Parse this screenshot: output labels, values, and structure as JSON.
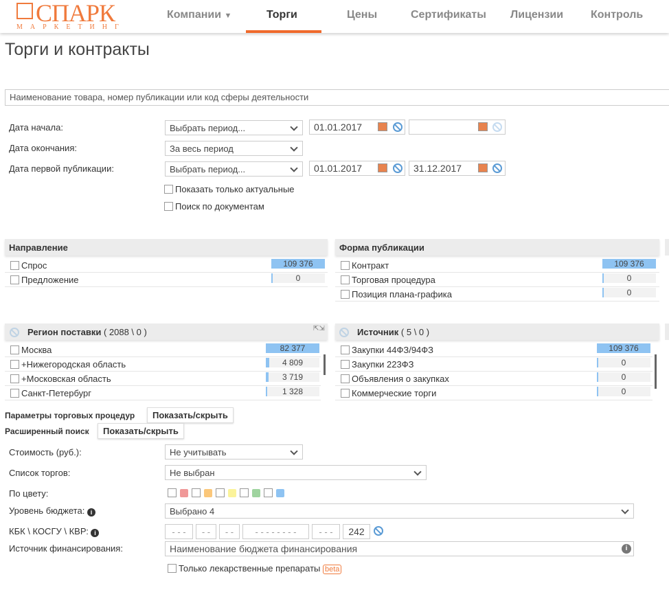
{
  "header": {
    "logo_text": "СПАРК",
    "logo_sub": "МАРКЕТИНГ",
    "nav": [
      "Компании",
      "Торги",
      "Цены",
      "Сертификаты",
      "Лицензии",
      "Контроль"
    ],
    "active": "Торги",
    "accent": "#f06a2c"
  },
  "page_title": "Торги и контракты",
  "search": {
    "placeholder": "Наименование товара, номер публикации или код сферы деятельности"
  },
  "dates": {
    "start": {
      "label": "Дата начала:",
      "period": "Выбрать период...",
      "from": "01.01.2017",
      "to": ""
    },
    "end": {
      "label": "Дата окончания:",
      "period": "За весь период"
    },
    "first_pub": {
      "label": "Дата первой публикации:",
      "period": "Выбрать период...",
      "from": "01.01.2017",
      "to": "31.12.2017"
    }
  },
  "checkboxes": {
    "actual": "Показать только актуальные",
    "docs": "Поиск по документам"
  },
  "panels": {
    "direction": {
      "title": "Направление",
      "items": [
        {
          "label": "Спрос",
          "count": "109 376",
          "share": 1
        },
        {
          "label": "Предложение",
          "count": "0",
          "share": 0
        }
      ]
    },
    "form": {
      "title": "Форма публикации",
      "items": [
        {
          "label": "Контракт",
          "count": "109 376",
          "share": 1
        },
        {
          "label": "Торговая процедура",
          "count": "0",
          "share": 0
        },
        {
          "label": "Позиция плана-графика",
          "count": "0",
          "share": 0
        }
      ]
    },
    "region": {
      "title": "Регион поставки",
      "counter": "( 2088 \\ 0 )",
      "items": [
        {
          "label": "Москва",
          "count": "82 377",
          "share": 1
        },
        {
          "label": "+Нижегородская область",
          "count": "4 809",
          "share": 0.06
        },
        {
          "label": "+Московская область",
          "count": "3 719",
          "share": 0.045
        },
        {
          "label": "Санкт-Петербург",
          "count": "1 328",
          "share": 0.016
        }
      ]
    },
    "source": {
      "title": "Источник",
      "counter": "( 5 \\ 0 )",
      "items": [
        {
          "label": "Закупки 44ФЗ/94ФЗ",
          "count": "109 376",
          "share": 1
        },
        {
          "label": "Закупки 223ФЗ",
          "count": "0",
          "share": 0
        },
        {
          "label": "Объявления о закупках",
          "count": "0",
          "share": 0
        },
        {
          "label": "Коммерческие торги",
          "count": "0",
          "share": 0
        }
      ]
    }
  },
  "sections": {
    "trade_params": "Параметры торговых процедур",
    "advanced": "Расширенный поиск",
    "toggle": "Показать/скрыть"
  },
  "advanced": {
    "cost": {
      "label": "Стоимость (руб.):",
      "value": "Не учитывать"
    },
    "list": {
      "label": "Список торгов:",
      "value": "Не выбран"
    },
    "color": {
      "label": "По цвету:",
      "colors": [
        "#f09898",
        "#fbc77a",
        "#fbf39a",
        "#9fd49f",
        "#8ec3f2"
      ]
    },
    "budget": {
      "label": "Уровень бюджета:",
      "value": "Выбрано 4"
    },
    "kbk": {
      "label": "КБК \\ КОСГУ \\ КВР:",
      "fields": [
        "- - -",
        "- -",
        "- -",
        "- - - - - - - -",
        "- - -",
        "242"
      ]
    },
    "finance": {
      "label": "Источник финансирования:",
      "placeholder": "Наименование бюджета финансирования"
    },
    "drugs": {
      "label": "Только лекарственные препараты",
      "badge": "beta"
    }
  }
}
